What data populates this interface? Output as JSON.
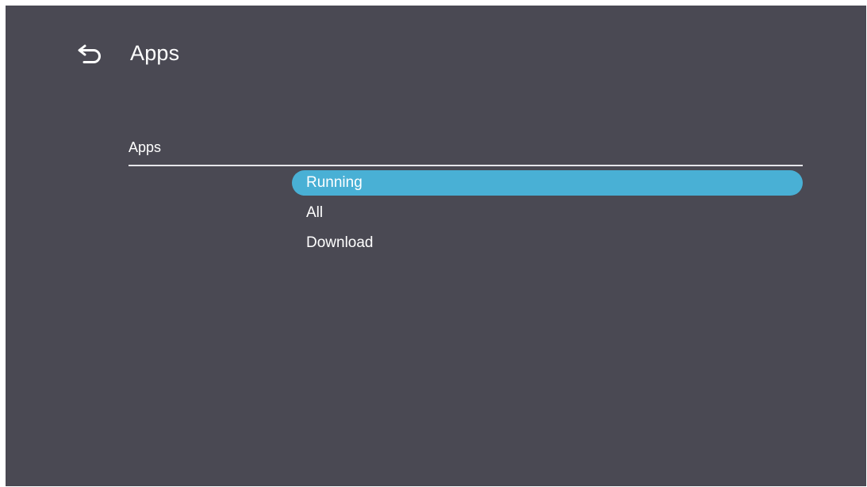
{
  "header": {
    "back_icon": "back-arrow-icon",
    "title": "Apps"
  },
  "section": {
    "label": "Apps"
  },
  "menu": {
    "items": [
      {
        "label": "Running",
        "selected": true
      },
      {
        "label": "All",
        "selected": false
      },
      {
        "label": "Download",
        "selected": false
      }
    ]
  },
  "colors": {
    "background": "#4a4953",
    "accent": "#49b0d5",
    "text": "#ffffff"
  }
}
